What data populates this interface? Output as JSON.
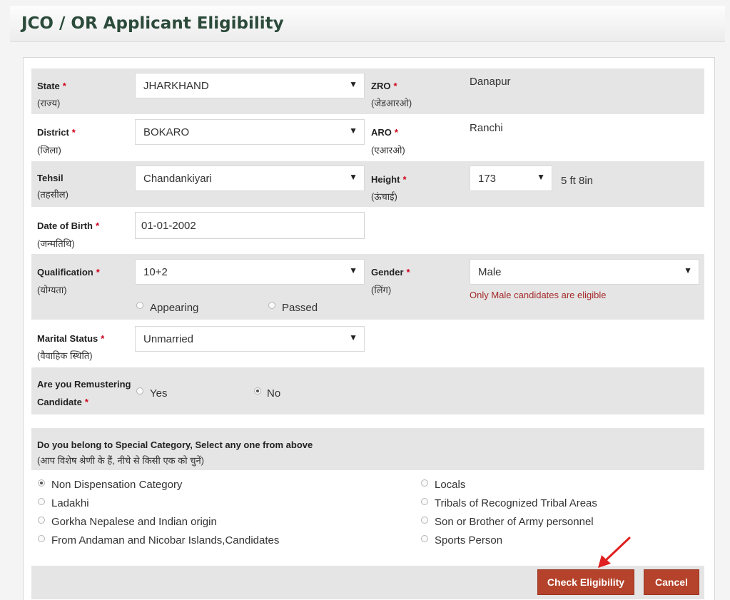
{
  "page_title": "JCO / OR Applicant Eligibility",
  "required_mark": "*",
  "fields": {
    "state": {
      "label": "State",
      "hindi": "(राज्य)",
      "value": "JHARKHAND"
    },
    "zro": {
      "label": "ZRO",
      "hindi": "(जेडआरओ)",
      "value": "Danapur"
    },
    "district": {
      "label": "District",
      "hindi": "(जिला)",
      "value": "BOKARO"
    },
    "aro": {
      "label": "ARO",
      "hindi": "(एआरओ)",
      "value": "Ranchi"
    },
    "tehsil": {
      "label": "Tehsil",
      "hindi": "(तहसील)",
      "value": "Chandankiyari"
    },
    "height": {
      "label": "Height",
      "hindi": "(ऊंचाई)",
      "value": "173",
      "converted": "5 ft 8in"
    },
    "dob": {
      "label": "Date of Birth",
      "hindi": "(जन्मतिथि)",
      "value": "01-01-2002"
    },
    "qualification": {
      "label": "Qualification",
      "hindi": "(योग्यता)",
      "value": "10+2",
      "options": [
        "Appearing",
        "Passed"
      ]
    },
    "gender": {
      "label": "Gender",
      "hindi": "(लिंग)",
      "value": "Male",
      "note": "Only Male candidates are eligible"
    },
    "marital": {
      "label": "Marital Status",
      "hindi": "(वैवाहिक स्थिति)",
      "value": "Unmarried"
    },
    "remuster": {
      "label_line1": "Are you Remustering",
      "label_line2": "Candidate",
      "options": [
        "Yes",
        "No"
      ],
      "selected": "No"
    }
  },
  "special": {
    "heading": "Do you belong to Special Category, Select any one from above",
    "hindi": "(आप विशेष श्रेणी के हैं, नीचे से किसी एक को चुनें)",
    "left": [
      "Non Dispensation Category",
      "Ladakhi",
      "Gorkha Nepalese and Indian origin",
      "From Andaman and Nicobar Islands,Candidates"
    ],
    "right": [
      "Locals",
      "Tribals of Recognized Tribal Areas",
      "Son or Brother of Army personnel",
      "Sports Person"
    ],
    "selected": "Non Dispensation Category"
  },
  "buttons": {
    "check": "Check Eligibility",
    "cancel": "Cancel"
  },
  "colors": {
    "button": "#b5432b",
    "required": "#d0021b",
    "error": "#a52a2a",
    "title": "#2b4a3a"
  }
}
